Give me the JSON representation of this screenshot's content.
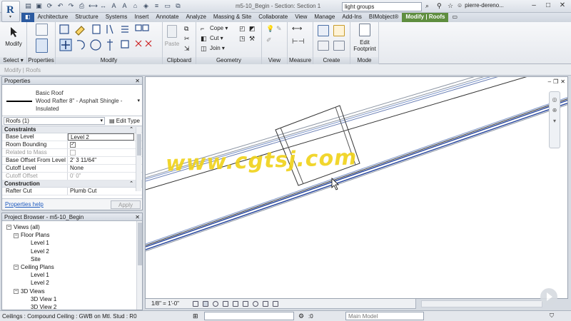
{
  "titlebar": {
    "window_title": "m5-10_Begin - Section: Section 1",
    "search_value": "light groups",
    "user_name": "pierre-dereno..."
  },
  "tabs": [
    "Architecture",
    "Structure",
    "Systems",
    "Insert",
    "Annotate",
    "Analyze",
    "Massing & Site",
    "Collaborate",
    "View",
    "Manage",
    "Add-Ins",
    "BIMobject®",
    "Modify | Roofs"
  ],
  "active_tab": "Modify | Roofs",
  "ribbon": {
    "modify_label": "Modify",
    "select_label": "Select ▾",
    "properties_label": "Properties",
    "modify_panel_label": "Modify",
    "clipboard_label": "Clipboard",
    "paste_label": "Paste",
    "geometry_label": "Geometry",
    "cope_label": "Cope ▾",
    "cut_label": "Cut ▾",
    "join_label": "Join ▾",
    "view_label": "View",
    "measure_label": "Measure",
    "create_label": "Create",
    "mode_label": "Mode",
    "edit_footprint_line1": "Edit",
    "edit_footprint_line2": "Footprint"
  },
  "optionsbar": {
    "text": "Modify | Roofs"
  },
  "properties": {
    "header": "Properties",
    "close": "✕",
    "type_line1": "Basic Roof",
    "type_line2": "Wood Rafter 8\" - Asphalt Shingle -",
    "type_line3": "Insulated",
    "instance_filter": "Roofs (1)",
    "edit_type": "Edit Type",
    "groups": {
      "constraints": "Constraints",
      "construction": "Construction"
    },
    "rows": {
      "base_level": {
        "k": "Base Level",
        "v": "Level 2"
      },
      "room_bounding": {
        "k": "Room Bounding",
        "v": "✓"
      },
      "related_to_mass": {
        "k": "Related to Mass",
        "v": ""
      },
      "base_offset": {
        "k": "Base Offset From Level",
        "v": "2'  3 11/64\""
      },
      "cutoff_level": {
        "k": "Cutoff Level",
        "v": "None"
      },
      "cutoff_offset": {
        "k": "Cutoff Offset",
        "v": "0'  0\""
      },
      "rafter_cut": {
        "k": "Rafter Cut",
        "v": "Plumb Cut"
      }
    },
    "help_link": "Properties help",
    "apply": "Apply"
  },
  "browser": {
    "header": "Project Browser - m5-10_Begin",
    "close": "✕",
    "items": [
      {
        "label": "Views (all)",
        "toggle": "−"
      },
      {
        "label": "Floor Plans",
        "toggle": "−"
      },
      {
        "label": "Level 1"
      },
      {
        "label": "Level 2"
      },
      {
        "label": "Site"
      },
      {
        "label": "Ceiling Plans",
        "toggle": "−"
      },
      {
        "label": "Level 1"
      },
      {
        "label": "Level 2"
      },
      {
        "label": "3D Views",
        "toggle": "−"
      },
      {
        "label": "3D View 1"
      },
      {
        "label": "3D View 2"
      }
    ]
  },
  "view": {
    "watermark": "www.cgtsj.com",
    "scale": "1/8\" = 1'-0\""
  },
  "statusbar": {
    "text": "Ceilings : Compound Ceiling : GWB on Mtl. Stud : R0",
    "zero": ":0",
    "model": "Main Model"
  },
  "colors": {
    "active_tab": "#5f8e3f",
    "roof_line": "#1f3f9a",
    "watermark": "#f0d218"
  }
}
